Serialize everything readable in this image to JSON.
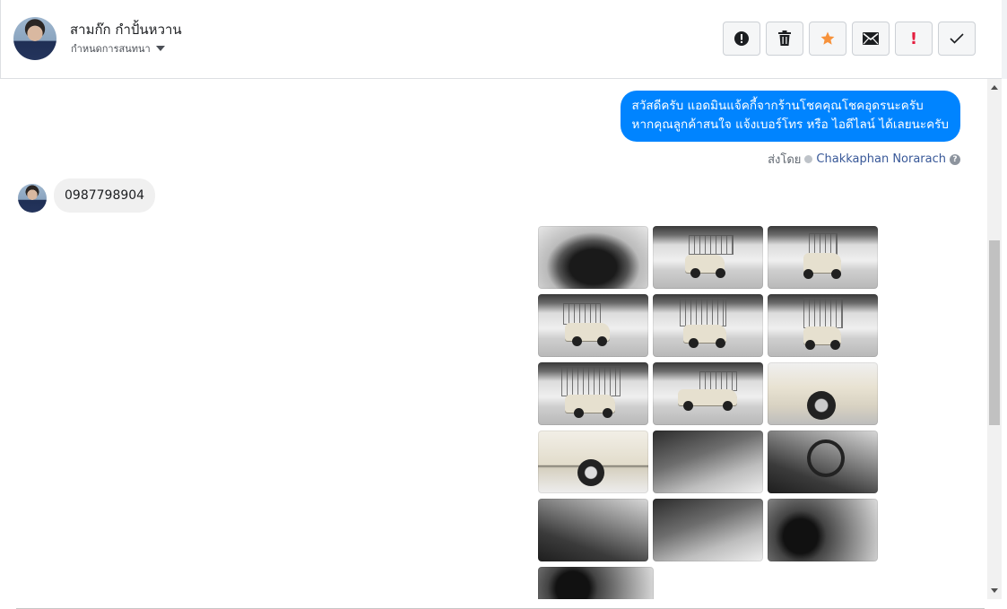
{
  "header": {
    "contact_name": "สามก๊ก กำปั้นหวาน",
    "assign_label": "กำหนดการสนทนา"
  },
  "toolbar": {
    "buttons": [
      {
        "name": "spam",
        "icon": "alert-circle-icon"
      },
      {
        "name": "delete",
        "icon": "trash-icon"
      },
      {
        "name": "star",
        "icon": "star-icon"
      },
      {
        "name": "mark-unread",
        "icon": "envelope-icon"
      },
      {
        "name": "follow-up",
        "icon": "exclamation-icon",
        "glyph": "!"
      },
      {
        "name": "done",
        "icon": "check-icon"
      }
    ],
    "star_color": "#f7923b",
    "followup_color": "#e41e3f"
  },
  "messages": {
    "outgoing": {
      "line1": "สวัสดีครับ แอดมินแจ้คกี้จากร้านโชคคุณโชคอุดรนะครับ",
      "line2": "หากคุณลูกค้าสนใจ แจ้งเบอร์โทร หรือ ไอดีไลน์ ได้เลยนะครับ",
      "bubble_color": "#0084ff"
    },
    "sent_by": {
      "prefix": "ส่งโดย",
      "sender": "Chakkaphan Norarach",
      "help": "?"
    },
    "incoming": {
      "text": "0987798904"
    }
  },
  "photos": {
    "count": 16,
    "items": [
      "engine-bay",
      "truck-front-right-rack",
      "truck-front-rack",
      "truck-rear-left-rack",
      "truck-rear-rack",
      "truck-rear-close",
      "truck-rear-left-rack-2",
      "truck-side-rack",
      "truck-front-wheel",
      "truck-side-wheel",
      "door-interior",
      "steering-wheel",
      "gear-shift",
      "seat-interior",
      "dashboard",
      "gauge-cluster"
    ]
  }
}
